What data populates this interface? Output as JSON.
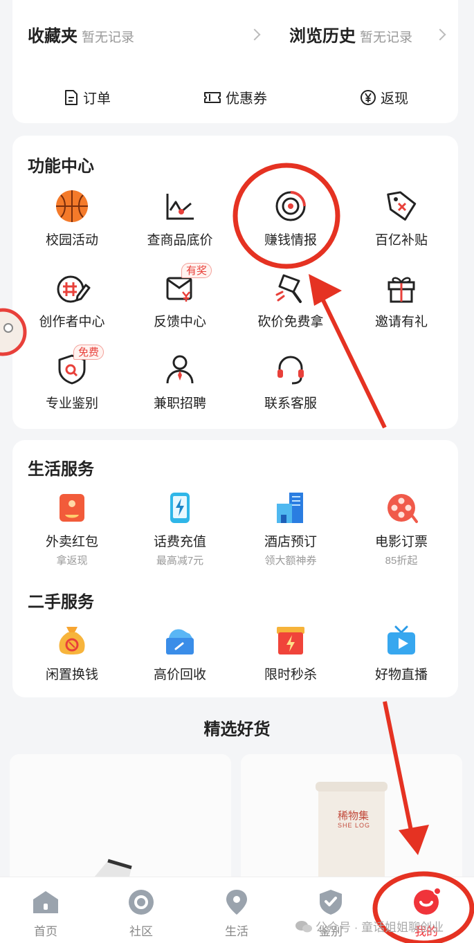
{
  "favorites": {
    "title": "收藏夹",
    "status": "暂无记录"
  },
  "history": {
    "title": "浏览历史",
    "status": "暂无记录"
  },
  "quick_links": [
    {
      "label": "订单",
      "icon": "order-icon"
    },
    {
      "label": "优惠券",
      "icon": "coupon-icon"
    },
    {
      "label": "返现",
      "icon": "yen-icon"
    }
  ],
  "function_center": {
    "title": "功能中心",
    "items": [
      {
        "label": "校园活动",
        "icon": "basketball-icon"
      },
      {
        "label": "查商品底价",
        "icon": "price-chart-icon"
      },
      {
        "label": "赚钱情报",
        "icon": "radar-icon"
      },
      {
        "label": "百亿补贴",
        "icon": "price-tag-icon"
      },
      {
        "label": "创作者中心",
        "icon": "creator-pen-icon"
      },
      {
        "label": "反馈中心",
        "icon": "feedback-icon",
        "badge": "有奖"
      },
      {
        "label": "砍价免费拿",
        "icon": "axe-icon"
      },
      {
        "label": "邀请有礼",
        "icon": "gift-icon"
      },
      {
        "label": "专业鉴别",
        "icon": "shield-search-icon",
        "badge": "免费"
      },
      {
        "label": "兼职招聘",
        "icon": "person-tie-icon"
      },
      {
        "label": "联系客服",
        "icon": "headset-icon"
      }
    ]
  },
  "life_services": {
    "title": "生活服务",
    "items": [
      {
        "label": "外卖红包",
        "sub": "拿返现",
        "icon": "takeout-icon"
      },
      {
        "label": "话费充值",
        "sub": "最高减7元",
        "icon": "phone-bolt-icon"
      },
      {
        "label": "酒店预订",
        "sub": "领大额神券",
        "icon": "hotel-icon"
      },
      {
        "label": "电影订票",
        "sub": "85折起",
        "icon": "film-reel-icon"
      }
    ]
  },
  "second_hand": {
    "title": "二手服务",
    "items": [
      {
        "label": "闲置换钱",
        "icon": "money-bag-icon"
      },
      {
        "label": "高价回收",
        "icon": "shoe-box-icon"
      },
      {
        "label": "限时秒杀",
        "icon": "flash-box-icon"
      },
      {
        "label": "好物直播",
        "icon": "tv-play-icon"
      }
    ]
  },
  "featured": {
    "title": "精选好货",
    "product_brand": "稀物集",
    "product_brand_en": "SHE LOG"
  },
  "bottom_nav": [
    {
      "label": "首页",
      "icon": "home-icon"
    },
    {
      "label": "社区",
      "icon": "community-icon"
    },
    {
      "label": "生活",
      "icon": "location-pin-icon"
    },
    {
      "label": "鉴别",
      "icon": "shield-check-icon"
    },
    {
      "label": "我的",
      "icon": "smile-face-icon"
    }
  ],
  "watermark": "公众号 · 童话姐姐聊创业",
  "colors": {
    "accent": "#e8403a",
    "annotation": "#e53222",
    "text": "#222222",
    "muted": "#999999"
  }
}
